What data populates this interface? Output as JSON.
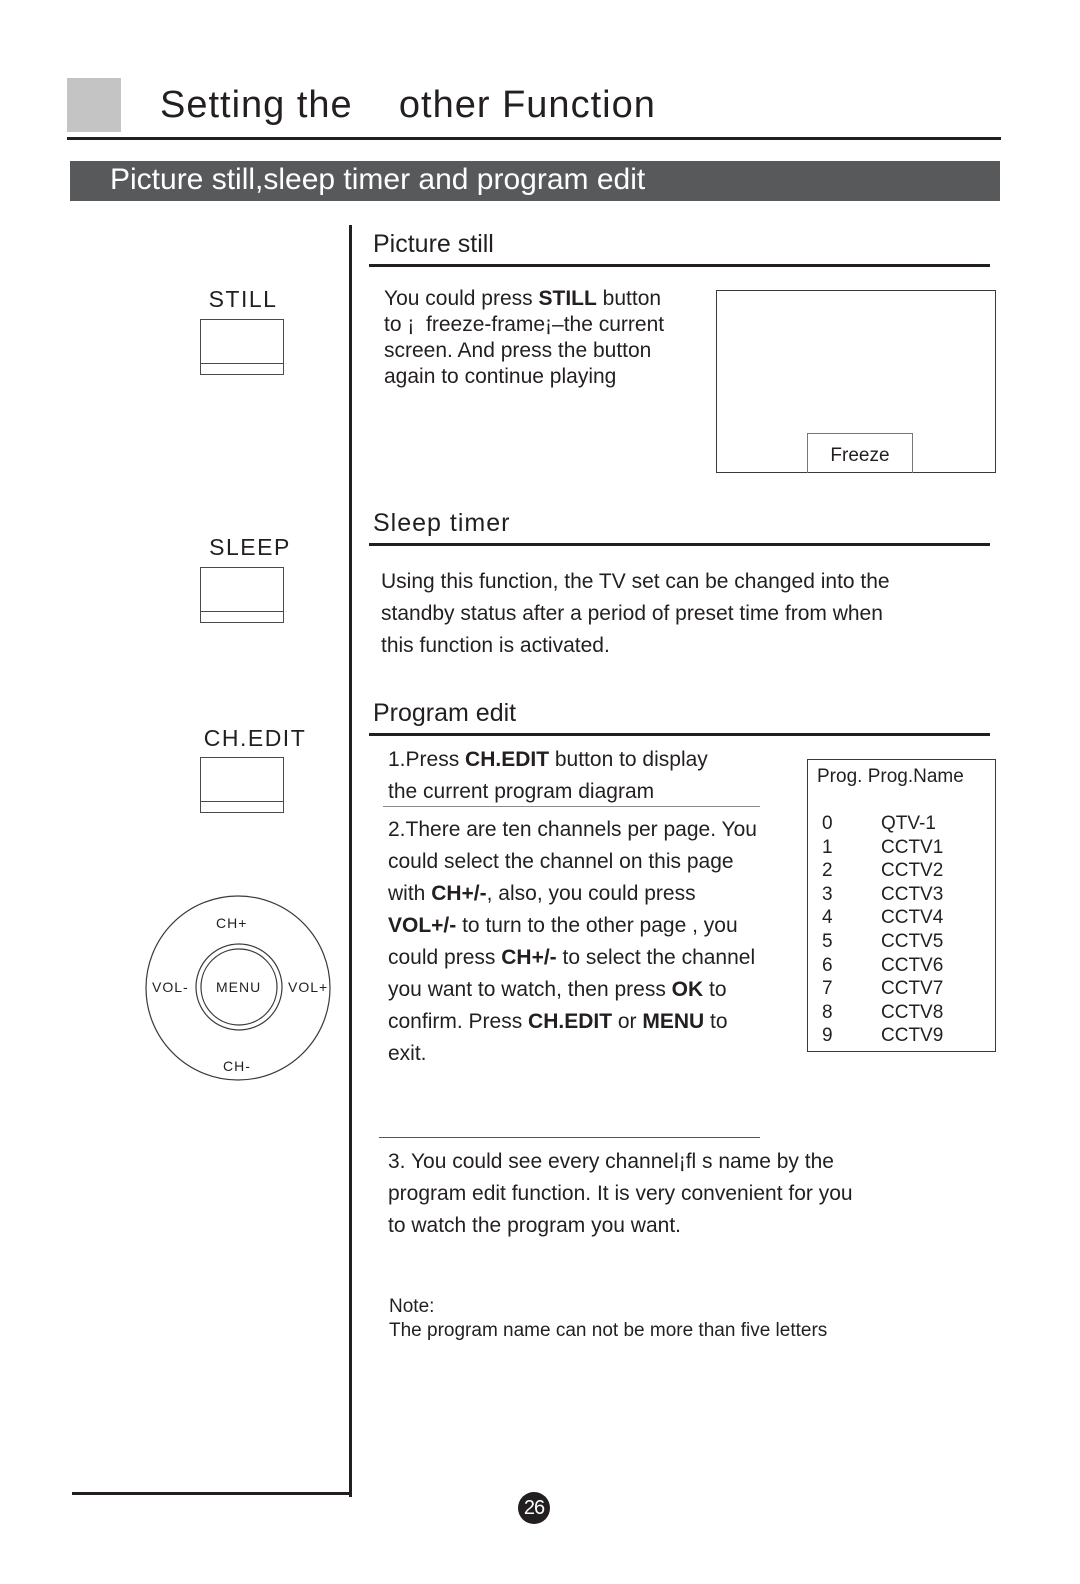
{
  "header": {
    "title": "Setting the    other Function",
    "section_title": "Picture still,sleep timer and program edit"
  },
  "buttons": {
    "still": "STILL",
    "sleep": "SLEEP",
    "ch_edit": "CH.EDIT"
  },
  "remote_pad": {
    "up": "CH+",
    "down": "CH-",
    "left": "VOL-",
    "right": "VOL+",
    "center": "MENU"
  },
  "picture_still": {
    "heading": "Picture still",
    "lines": [
      {
        "pre": "You could press ",
        "bold": "STILL",
        "post": " button"
      },
      {
        "pre": "to ¡  freeze-frame¡–the current",
        "bold": "",
        "post": ""
      },
      {
        "pre": "screen. And press the button",
        "bold": "",
        "post": ""
      },
      {
        "pre": "again to continue playing",
        "bold": "",
        "post": ""
      }
    ],
    "screen_label": "Freeze"
  },
  "sleep_timer": {
    "heading": "Sleep timer",
    "lines": [
      "Using this function, the TV set can be changed into the",
      "standby status after a period of preset time from when",
      "this function is activated."
    ]
  },
  "program_edit": {
    "heading": "Program edit",
    "step1": {
      "line1_pre": "1.Press ",
      "line1_bold": "CH.EDIT",
      "line1_post": " button to display",
      "line2": "the current program diagram"
    },
    "step2": {
      "l1": "2.There are ten channels per page. You",
      "l2": "could select the channel on this page",
      "l3_pre": "with ",
      "l3_bold": "CH+/-",
      "l3_post": ", also, you could press",
      "l4_bold": "VOL+/-",
      "l4_post": " to turn to the other page , you",
      "l5_pre": "could press ",
      "l5_bold": "CH+/-",
      "l5_post": " to select the channel",
      "l6_pre": "you want to watch, then press ",
      "l6_bold": "OK",
      "l6_post": " to",
      "l7_pre": "confirm. Press ",
      "l7_bold1": "CH.EDIT",
      "l7_mid": " or ",
      "l7_bold2": "MENU",
      "l7_post": " to",
      "l8": "exit."
    },
    "step3": [
      "3. You could see every channel¡fl s name by the",
      "program edit function. It is very convenient for you",
      "to watch the program you want."
    ],
    "note_label": "Note:",
    "note_text": "The program name can not be more than five letters",
    "table": {
      "header": "Prog. Prog.Name",
      "rows": [
        {
          "prog": "0",
          "name": "QTV-1"
        },
        {
          "prog": "1",
          "name": "CCTV1"
        },
        {
          "prog": "2",
          "name": "CCTV2"
        },
        {
          "prog": "3",
          "name": "CCTV3"
        },
        {
          "prog": "4",
          "name": "CCTV4"
        },
        {
          "prog": "5",
          "name": "CCTV5"
        },
        {
          "prog": "6",
          "name": "CCTV6"
        },
        {
          "prog": "7",
          "name": "CCTV7"
        },
        {
          "prog": "8",
          "name": "CCTV8"
        },
        {
          "prog": "9",
          "name": "CCTV9"
        }
      ]
    }
  },
  "page_number": "26"
}
